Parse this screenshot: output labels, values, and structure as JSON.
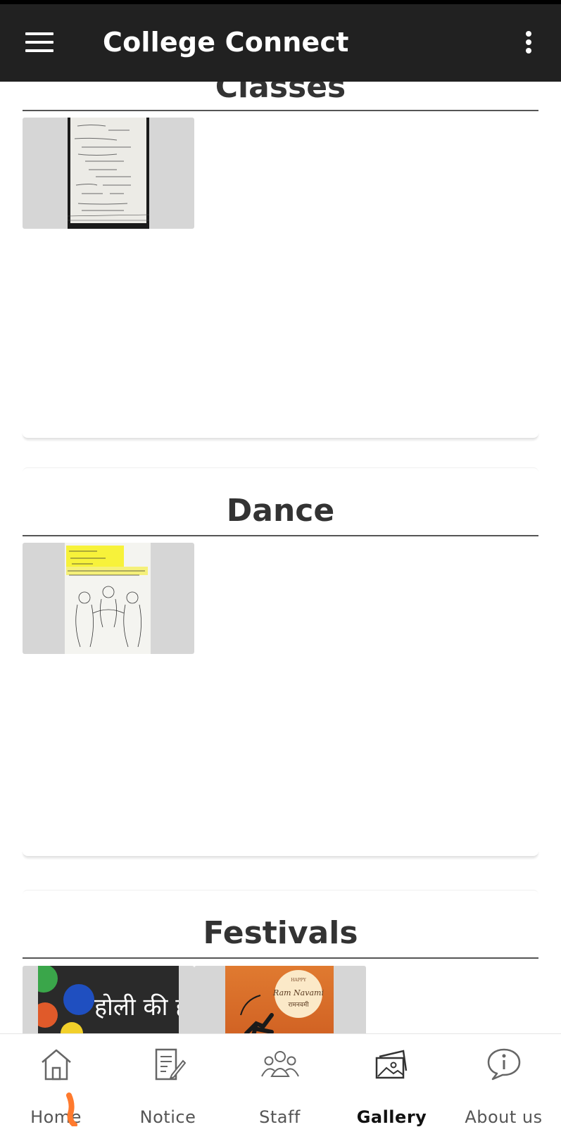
{
  "app": {
    "title": "College Connect"
  },
  "appbar": {
    "menu_icon": "hamburger-menu-icon",
    "more_icon": "more-vertical-icon"
  },
  "gallery": {
    "sections": [
      {
        "title": "Classes",
        "images": [
          "handwritten-notes-photo"
        ]
      },
      {
        "title": "Dance",
        "images": [
          "sketch-drawing-photo"
        ]
      },
      {
        "title": "Festivals",
        "images": [
          "holi-greeting-photo",
          "ram-navami-greeting-photo"
        ]
      }
    ],
    "image_text": {
      "holi": "होली की हार्दिक",
      "ram_top": "HAPPY",
      "ram_main": "Ram Navami",
      "ram_hindi": "रामनवमी"
    }
  },
  "bottom_nav": {
    "items": [
      {
        "label": "Home",
        "icon": "home-icon",
        "active": false
      },
      {
        "label": "Notice",
        "icon": "notice-icon",
        "active": false
      },
      {
        "label": "Staff",
        "icon": "staff-group-icon",
        "active": false
      },
      {
        "label": "Gallery",
        "icon": "gallery-icon",
        "active": true
      },
      {
        "label": "About us",
        "icon": "info-icon",
        "active": false
      }
    ]
  },
  "colors": {
    "appbar": "#212121",
    "thumb_bg": "#d6d6d6",
    "accent_mark": "#ff7a2e"
  }
}
